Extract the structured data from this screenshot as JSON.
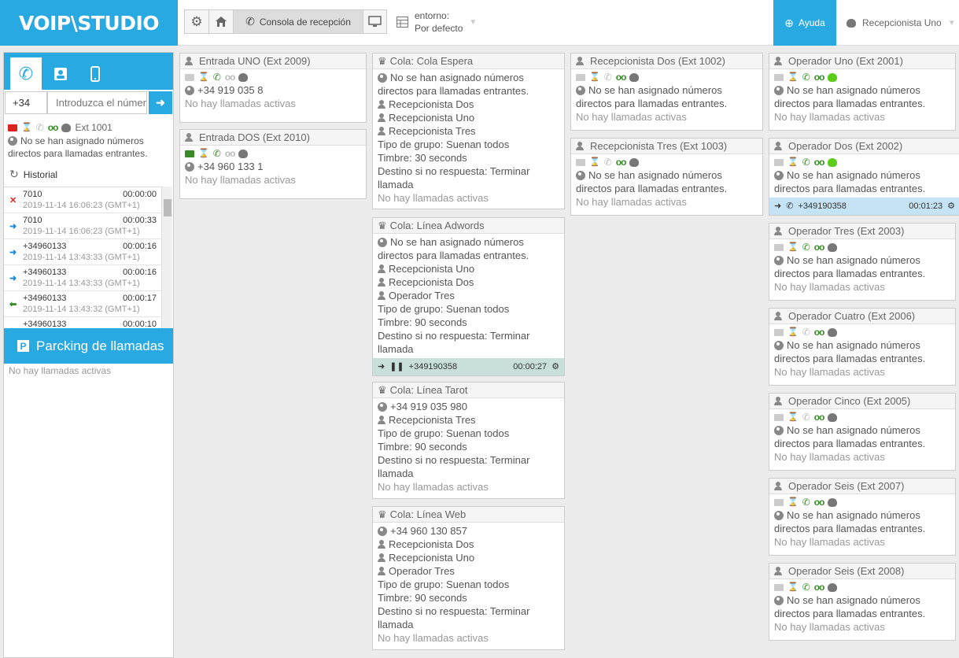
{
  "app": {
    "logo": "VOIP\\STUDIO"
  },
  "toolbar": {
    "console_label": "Consola de recepción",
    "env_label": "entorno:",
    "env_value": "Por defecto",
    "help_label": "Ayuda",
    "user_name": "Recepcionista Uno"
  },
  "left": {
    "country_code": "+34",
    "dial_placeholder": "Introduzca el número",
    "my_ext": "Ext 1001",
    "no_numbers": "No se han asignado números directos para llamadas entrantes.",
    "history_label": "Historial",
    "history": [
      {
        "num": "7010",
        "dur": "00:00:00",
        "dt": "2019-11-14 16:06:23 (GMT+1)",
        "type": "missed"
      },
      {
        "num": "7010",
        "dur": "00:00:33",
        "dt": "2019-11-14 16:06:23 (GMT+1)",
        "type": "out"
      },
      {
        "num": "+34960133",
        "dur": "00:00:16",
        "dt": "2019-11-14 13:43:33 (GMT+1)",
        "type": "out"
      },
      {
        "num": "+34960133",
        "dur": "00:00:16",
        "dt": "2019-11-14 13:43:33 (GMT+1)",
        "type": "out"
      },
      {
        "num": "+34960133",
        "dur": "00:00:17",
        "dt": "2019-11-14 13:43:32 (GMT+1)",
        "type": "in"
      },
      {
        "num": "+34960133",
        "dur": "00:00:10",
        "dt": "",
        "type": "in"
      }
    ],
    "parking_label": "Parcking de llamadas",
    "parking_empty": "No hay llamadas activas"
  },
  "col1": [
    {
      "title": "Entrada UNO (Ext 2009)",
      "number": "+34 919 035 8",
      "empty": "No hay llamadas activas",
      "mail": "x"
    },
    {
      "title": "Entrada DOS (Ext 2010)",
      "number": "+34 960 133 1",
      "empty": "No hay llamadas activas",
      "mail": "g"
    }
  ],
  "col2": [
    {
      "title": "Cola: Cola Espera",
      "nonum": "No se han asignado números directos para llamadas entrantes.",
      "members": [
        "Recepcionista Dos",
        "Recepcionista Uno",
        "Recepcionista Tres"
      ],
      "group": "Tipo de grupo: Suenan todos",
      "ring": "Timbre: 30 seconds",
      "dest": "Destino si no respuesta: Terminar llamada",
      "empty": "No hay llamadas activas"
    },
    {
      "title": "Cola: Línea Adwords",
      "nonum": "No se han asignado números directos para llamadas entrantes.",
      "members": [
        "Recepcionista Uno",
        "Recepcionista Dos",
        "Operador Tres"
      ],
      "group": "Tipo de grupo: Suenan todos",
      "ring": "Timbre: 90 seconds",
      "dest": "Destino si no respuesta: Terminar llamada",
      "call_num": "+349190358",
      "call_time": "00:00:27"
    },
    {
      "title": "Cola: Línea Tarot",
      "number": "+34 919 035 980",
      "members": [
        "Recepcionista Tres"
      ],
      "group": "Tipo de grupo: Suenan todos",
      "ring": "Timbre: 90 seconds",
      "dest": "Destino si no respuesta: Terminar llamada",
      "empty": "No hay llamadas activas"
    },
    {
      "title": "Cola: Línea Web",
      "number": "+34 960 130 857",
      "members": [
        "Recepcionista Dos",
        "Recepcionista Uno",
        "Operador Tres"
      ],
      "group": "Tipo de grupo: Suenan todos",
      "ring": "Timbre: 90 seconds",
      "dest": "Destino si no respuesta: Terminar llamada",
      "empty": "No hay llamadas activas"
    }
  ],
  "col3": [
    {
      "title": "Recepcionista Dos (Ext 1002)",
      "nonum": "No se han asignado números directos para llamadas entrantes.",
      "empty": "No hay llamadas activas"
    },
    {
      "title": "Recepcionista Tres (Ext 1003)",
      "nonum": "No se han asignado números directos para llamadas entrantes.",
      "empty": "No hay llamadas activas"
    }
  ],
  "col4": [
    {
      "title": "Operador Uno (Ext 2001)",
      "nonum": "No se han asignado números directos para llamadas entrantes.",
      "empty": "No hay llamadas activas",
      "status": "green"
    },
    {
      "title": "Operador Dos (Ext 2002)",
      "nonum": "No se han asignado números directos para llamadas entrantes.",
      "call_num": "+349190358",
      "call_time": "00:01:23",
      "status": "green"
    },
    {
      "title": "Operador Tres (Ext 2003)",
      "nonum": "No se han asignado números directos para llamadas entrantes.",
      "empty": "No hay llamadas activas"
    },
    {
      "title": "Operador Cuatro (Ext 2006)",
      "nonum": "No se han asignado números directos para llamadas entrantes.",
      "empty": "No hay llamadas activas"
    },
    {
      "title": "Operador Cinco (Ext 2005)",
      "nonum": "No se han asignado números directos para llamadas entrantes.",
      "empty": "No hay llamadas activas"
    },
    {
      "title": "Operador Seis (Ext 2007)",
      "nonum": "No se han asignado números directos para llamadas entrantes.",
      "empty": "No hay llamadas activas"
    },
    {
      "title": "Operador Seis (Ext 2008)",
      "nonum": "No se han asignado números directos para llamadas entrantes.",
      "empty": "No hay llamadas activas"
    }
  ]
}
